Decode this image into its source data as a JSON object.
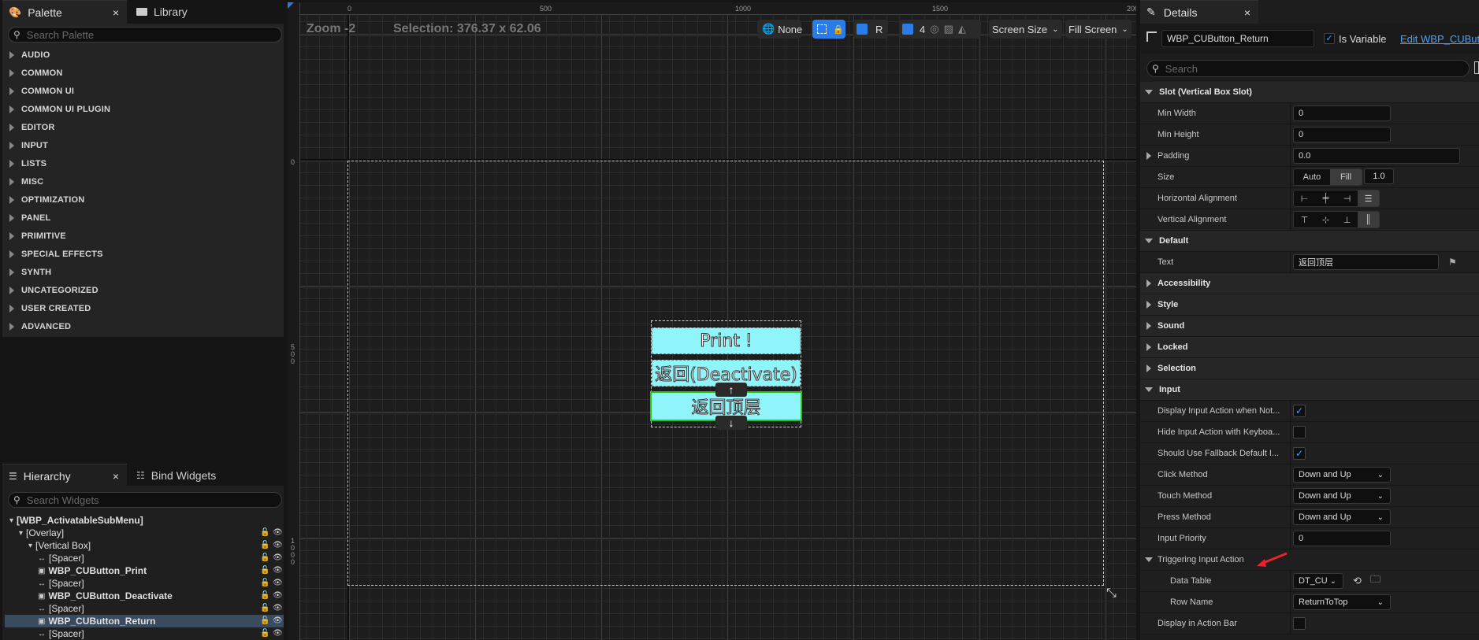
{
  "palette": {
    "tab_label": "Palette",
    "library_tab_label": "Library",
    "close_glyph": "×",
    "search_placeholder": "Search Palette",
    "categories": [
      "AUDIO",
      "COMMON",
      "COMMON UI",
      "COMMON UI PLUGIN",
      "EDITOR",
      "INPUT",
      "LISTS",
      "MISC",
      "OPTIMIZATION",
      "PANEL",
      "PRIMITIVE",
      "SPECIAL EFFECTS",
      "SYNTH",
      "UNCATEGORIZED",
      "USER CREATED",
      "ADVANCED"
    ]
  },
  "hierarchy": {
    "tab_label": "Hierarchy",
    "bind_tab_label": "Bind Widgets",
    "close_glyph": "×",
    "search_placeholder": "Search Widgets",
    "items": [
      {
        "label": "[WBP_ActivatableSubMenu]",
        "bold": true
      },
      {
        "label": "[Overlay]",
        "bold": false
      },
      {
        "label": "[Vertical Box]",
        "bold": false
      },
      {
        "label": "[Spacer]",
        "bold": false
      },
      {
        "label": "WBP_CUButton_Print",
        "bold": true
      },
      {
        "label": "[Spacer]",
        "bold": false
      },
      {
        "label": "WBP_CUButton_Deactivate",
        "bold": true
      },
      {
        "label": "[Spacer]",
        "bold": false
      },
      {
        "label": "WBP_CUButton_Return",
        "bold": true,
        "selected": true
      },
      {
        "label": "[Spacer]",
        "bold": false
      }
    ]
  },
  "canvas": {
    "zoom_label": "Zoom -2",
    "selection_label": "Selection: 376.37 x 62.06",
    "ruler_top": [
      "0",
      "500",
      "1000",
      "1500",
      "200"
    ],
    "ruler_left": [
      "0",
      "5\n0\n0",
      "1\n0\n0\n0"
    ],
    "toolbar": {
      "none_label": "None",
      "r_label": "R",
      "grid_count": "4",
      "screen_size_label": "Screen Size",
      "fill_screen_label": "Fill Screen"
    },
    "buttons": [
      {
        "text": "Print !"
      },
      {
        "text": "返回(Deactivate)"
      },
      {
        "text": "返回顶层"
      }
    ],
    "arrow_up": "↑",
    "arrow_down": "↓"
  },
  "details": {
    "tab_label": "Details",
    "close_glyph": "×",
    "widget_name": "WBP_CUButton_Return",
    "is_variable_label": "Is Variable",
    "edit_link": "Edit WBP_CUButt",
    "search_placeholder": "Search",
    "slot_section": "Slot (Vertical Box Slot)",
    "min_width": {
      "label": "Min Width",
      "value": "0"
    },
    "min_height": {
      "label": "Min Height",
      "value": "0"
    },
    "padding": {
      "label": "Padding",
      "value": "0.0"
    },
    "size": {
      "label": "Size",
      "auto": "Auto",
      "fill": "Fill",
      "value": "1.0"
    },
    "h_align_label": "Horizontal Alignment",
    "v_align_label": "Vertical Alignment",
    "default_section": "Default",
    "text": {
      "label": "Text",
      "value": "返回顶层"
    },
    "collapsed_sections": [
      "Accessibility",
      "Style",
      "Sound",
      "Locked",
      "Selection"
    ],
    "input_section": "Input",
    "input_rows": [
      {
        "label": "Display Input Action when Not...",
        "checked": true
      },
      {
        "label": "Hide Input Action with Keyboa...",
        "checked": false
      },
      {
        "label": "Should Use Fallback Default I...",
        "checked": true
      }
    ],
    "click_method": {
      "label": "Click Method",
      "value": "Down and Up"
    },
    "touch_method": {
      "label": "Touch Method",
      "value": "Down and Up"
    },
    "press_method": {
      "label": "Press Method",
      "value": "Down and Up"
    },
    "input_priority": {
      "label": "Input Priority",
      "value": "0"
    },
    "triggering_section": "Triggering Input Action",
    "data_table": {
      "label": "Data Table",
      "value": "DT_CU"
    },
    "row_name": {
      "label": "Row Name",
      "value": "ReturnToTop"
    },
    "display_in_action_bar": {
      "label": "Display in Action Bar",
      "checked": false
    }
  },
  "colors": {
    "accent": "#2a7ce8",
    "button_fill": "#8ff5fb",
    "selected_outline": "#22c41e",
    "annotation_arrow": "#e8242a"
  }
}
